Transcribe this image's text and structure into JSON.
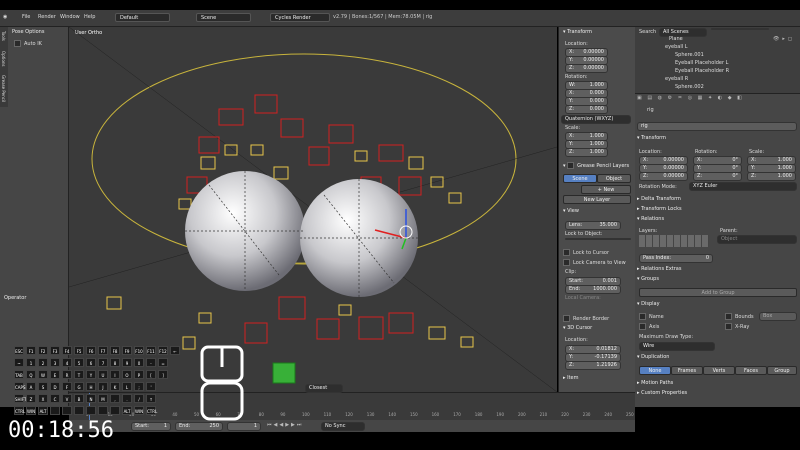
{
  "topbar": {
    "menus": [
      "File",
      "Render",
      "Window",
      "Help"
    ],
    "layout": "Default",
    "scene": "Scene",
    "engine": "Cycles Render",
    "stats": "v2.79 | Bones:1/567 | Mem:78.05M | rig"
  },
  "tools": {
    "pose_options": "Pose Options",
    "auto_ik": "Auto IK",
    "operator": "Operator",
    "tabs": [
      "Tools",
      "Options",
      "Grease Pencil"
    ]
  },
  "viewport": {
    "view_label": "User Ortho"
  },
  "npanel": {
    "transform_title": "Transform",
    "location_label": "Location:",
    "location": [
      {
        "k": "X:",
        "v": "0.00000"
      },
      {
        "k": "Y:",
        "v": "0.00000"
      },
      {
        "k": "Z:",
        "v": "0.00000"
      }
    ],
    "rotation_label": "Rotation:",
    "rotation": [
      {
        "k": "W:",
        "v": "1.000"
      },
      {
        "k": "X:",
        "v": "0.000"
      },
      {
        "k": "Y:",
        "v": "0.000"
      },
      {
        "k": "Z:",
        "v": "0.000"
      }
    ],
    "rotation_mode": "Quaternion (WXYZ)",
    "scale_label": "Scale:",
    "scale": [
      {
        "k": "X:",
        "v": "1.000"
      },
      {
        "k": "Y:",
        "v": "1.000"
      },
      {
        "k": "Z:",
        "v": "1.000"
      }
    ],
    "grease_title": "Grease Pencil Layers",
    "gp_scene": "Scene",
    "gp_object": "Object",
    "gp_new": "New",
    "gp_new_layer": "New Layer",
    "view_title": "View",
    "lens": {
      "k": "Lens:",
      "v": "35.000"
    },
    "lock_to_object": "Lock to Object:",
    "lock_to_cursor": "Lock to Cursor",
    "lock_camera": "Lock Camera to View",
    "clip_label": "Clip:",
    "clip_start": {
      "k": "Start:",
      "v": "0.001"
    },
    "clip_end": {
      "k": "End:",
      "v": "1000.000"
    },
    "local_camera": "Local Camera:",
    "render_border": "Render Border",
    "cursor_title": "3D Cursor",
    "cursor_location": "Location:",
    "cursor": [
      {
        "k": "X:",
        "v": "0.01812"
      },
      {
        "k": "Y:",
        "v": "-0.17139"
      },
      {
        "k": "Z:",
        "v": "1.21926"
      }
    ],
    "item_title": "Item"
  },
  "outliner": {
    "search_label": "Search",
    "scenes": "All Scenes",
    "items": [
      "Plane",
      "eyeball L",
      "Sphere.001",
      "Eyeball Placeholder L",
      "Eyeball Placeholder R",
      "eyeball R",
      "Sphere.002"
    ]
  },
  "props": {
    "object_name": "rig",
    "breadcrumb": "rig",
    "transform_title": "Transform",
    "loc_label": "Location:",
    "rot_label": "Rotation:",
    "scale_label": "Scale:",
    "loc": [
      {
        "k": "X:",
        "v": "0.00000"
      },
      {
        "k": "Y:",
        "v": "0.00000"
      },
      {
        "k": "Z:",
        "v": "0.00000"
      }
    ],
    "rot": [
      {
        "k": "X:",
        "v": "0°"
      },
      {
        "k": "Y:",
        "v": "0°"
      },
      {
        "k": "Z:",
        "v": "0°"
      }
    ],
    "scl": [
      {
        "k": "X:",
        "v": "1.000"
      },
      {
        "k": "Y:",
        "v": "1.000"
      },
      {
        "k": "Z:",
        "v": "1.000"
      }
    ],
    "rotation_mode_label": "Rotation Mode:",
    "rotation_mode": "XYZ Euler",
    "delta_transform": "Delta Transform",
    "transform_locks": "Transform Locks",
    "relations": "Relations",
    "layers_label": "Layers:",
    "parent_label": "Parent:",
    "parent_value": "Object",
    "pass_index": {
      "k": "Pass Index:",
      "v": "0"
    },
    "relations_extras": "Relations Extras",
    "groups": "Groups",
    "add_to_group": "Add to Group",
    "display": "Display",
    "name": "Name",
    "axis": "Axis",
    "bounds": "Bounds",
    "bounds_value": "Box",
    "xray": "X-Ray",
    "max_draw_type_label": "Maximum Draw Type:",
    "max_draw_type": "Wire",
    "duplication": "Duplication",
    "dup_tabs": [
      "None",
      "Frames",
      "Verts",
      "Faces",
      "Group"
    ],
    "motion_paths": "Motion Paths",
    "custom_properties": "Custom Properties"
  },
  "timeline": {
    "ticks": [
      "0",
      "10",
      "20",
      "30",
      "40",
      "50",
      "60",
      "70",
      "80",
      "90",
      "100",
      "110",
      "120",
      "130",
      "140",
      "150",
      "160",
      "170",
      "180",
      "190",
      "200",
      "210",
      "220",
      "230",
      "240",
      "250"
    ],
    "start": {
      "k": "Start:",
      "v": "1"
    },
    "end": {
      "k": "End:",
      "v": "250"
    },
    "current": "1",
    "sync": "No Sync",
    "mode": "Closest"
  },
  "keyboard": {
    "rows": [
      [
        "ESC",
        "F1",
        "F2",
        "F3",
        "F4",
        "F5",
        "F6",
        "F7",
        "F8",
        "F9",
        "F10",
        "F11",
        "F12",
        "←"
      ],
      [
        "~",
        "1",
        "2",
        "3",
        "4",
        "5",
        "6",
        "7",
        "8",
        "9",
        "0",
        "-",
        "="
      ],
      [
        "TAB",
        "Q",
        "W",
        "E",
        "R",
        "T",
        "Y",
        "U",
        "I",
        "O",
        "P",
        "[",
        "]"
      ],
      [
        "CAPS",
        "A",
        "S",
        "D",
        "F",
        "G",
        "H",
        "J",
        "K",
        "L",
        ";",
        "'"
      ],
      [
        "SHIFT",
        "Z",
        "X",
        "C",
        "V",
        "B",
        "N",
        "M",
        ",",
        ".",
        "/",
        "↑"
      ],
      [
        "CTRL",
        "WIN",
        "ALT",
        "",
        "",
        "",
        "",
        "",
        "",
        "ALT",
        "WIN",
        "CTRL"
      ]
    ]
  },
  "clock": "00:18:56",
  "colors": {
    "accent": "#5680c2",
    "header": "#3d3d3d",
    "panel": "#4b4b4b",
    "viewport": "#3a3a3a",
    "bone": "#d32020",
    "select": "#e8c54a"
  }
}
